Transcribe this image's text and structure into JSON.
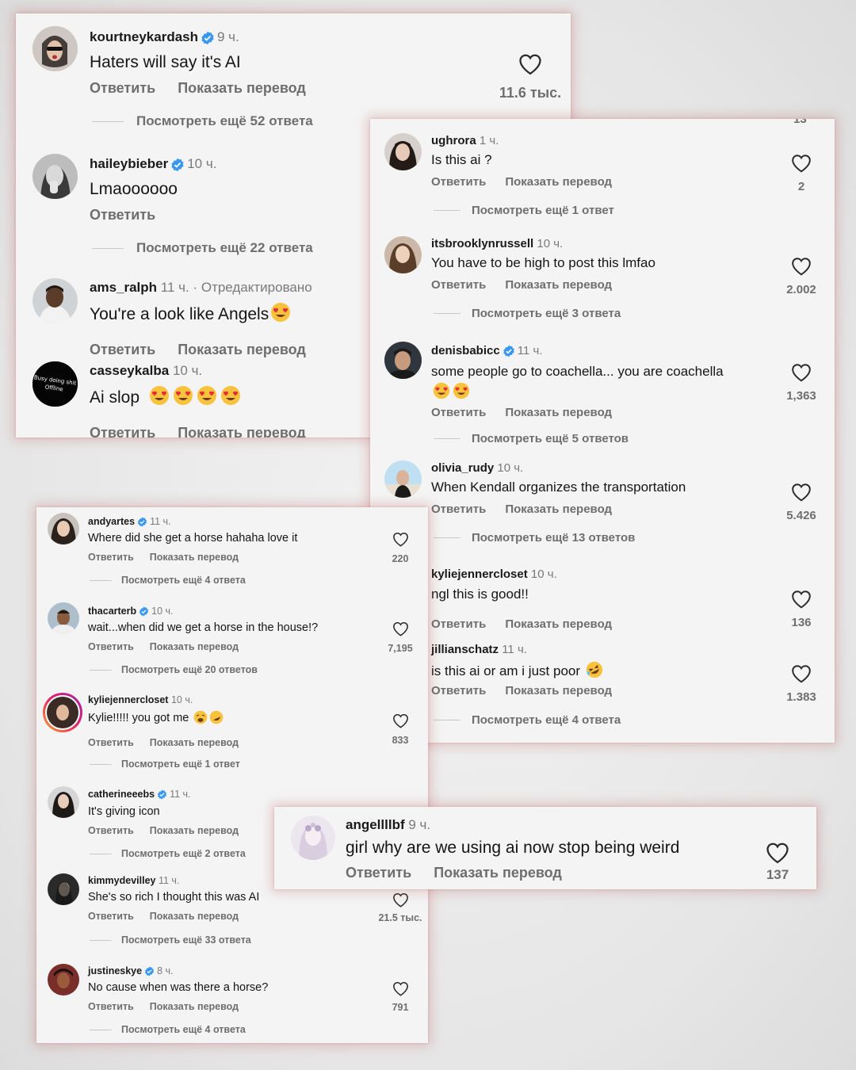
{
  "labels": {
    "reply": "Ответить",
    "translate": "Показать перевод"
  },
  "colors": {
    "verified": "#3897f0",
    "panel_glow": "#c86464",
    "panel_bg": "#f4f4f4"
  },
  "panel_a": {
    "comments": [
      {
        "user": "kourtneykardash",
        "verified": true,
        "time": "9 ч.",
        "text": "Haters will say it's AI",
        "likes": "11.6 тыс.",
        "replies": "Посмотреть ещё 52 ответа",
        "translate": true,
        "avatar_icon": "avatar-icon"
      },
      {
        "user": "haileybieber",
        "verified": true,
        "time": "10 ч.",
        "text": "Lmaoooooo",
        "likes": "",
        "replies": "Посмотреть ещё 22 ответа",
        "translate": false,
        "avatar_icon": "avatar-icon"
      },
      {
        "user": "ams_ralph",
        "verified": false,
        "time": "11 ч. · Отредактировано",
        "text": "You're a look like Angels",
        "emoji_count": 1,
        "likes": "",
        "replies": "",
        "translate": true,
        "avatar_icon": "avatar-icon"
      },
      {
        "user": "casseykalba",
        "verified": false,
        "time": "10 ч.",
        "text": "Ai slop",
        "emoji_count": 4,
        "likes": "",
        "replies": "",
        "translate": true,
        "avatar_text": "Busy doing shit Offline",
        "avatar_icon": "avatar-icon"
      }
    ]
  },
  "panel_b": {
    "top_partial_count": "13",
    "comments": [
      {
        "user": "ughrora",
        "verified": false,
        "time": "1 ч.",
        "text": "Is this ai ?",
        "likes": "2",
        "replies": "Посмотреть ещё 1 ответ"
      },
      {
        "user": "itsbrooklynrussell",
        "verified": false,
        "time": "10 ч.",
        "text": "You have to be high to post this lmfao",
        "likes": "2.002",
        "replies": "Посмотреть ещё 3 ответа"
      },
      {
        "user": "denisbabicc",
        "verified": true,
        "time": "11 ч.",
        "text": "some people go to coachella... you are coachella",
        "emoji_count": 2,
        "likes": "1,363",
        "replies": "Посмотреть ещё 5 ответов"
      },
      {
        "user": "olivia_rudy",
        "verified": false,
        "time": "10 ч.",
        "text": "When Kendall organizes the transportation",
        "likes": "5.426",
        "replies": "Посмотреть ещё 13 ответов"
      },
      {
        "user": "kyliejennercloset",
        "verified": false,
        "time": "10 ч.",
        "text": "ngl this is good!!",
        "likes": "136",
        "replies": ""
      },
      {
        "user": "jillianschatz",
        "verified": false,
        "time": "11 ч.",
        "text": "is this ai or am i just poor",
        "emoji_count": 1,
        "likes": "1.383",
        "replies": "Посмотреть ещё 4 ответа"
      }
    ]
  },
  "panel_c": {
    "comments": [
      {
        "user": "andyartes",
        "verified": true,
        "time": "11 ч.",
        "text": "Where did she get a horse hahaha love it",
        "likes": "220",
        "replies": "Посмотреть ещё 4 ответа"
      },
      {
        "user": "thacarterb",
        "verified": true,
        "time": "10 ч.",
        "text": "wait...when did we get a horse in the house!?",
        "likes": "7,195",
        "replies": "Посмотреть ещё 20 ответов"
      },
      {
        "user": "kyliejennercloset",
        "verified": false,
        "time": "10 ч.",
        "text": "Kylie!!!!! you got me",
        "emoji_count": 2,
        "likes": "833",
        "replies": "Посмотреть ещё 1 ответ"
      },
      {
        "user": "catherineeebs",
        "verified": true,
        "time": "11 ч.",
        "text": "It's giving icon",
        "likes": "",
        "replies": "Посмотреть ещё 2 ответа"
      },
      {
        "user": "kimmydevilley",
        "verified": false,
        "time": "11 ч.",
        "text": "She's so rich I thought this was AI",
        "likes": "21.5 тыс.",
        "replies": "Посмотреть ещё 33 ответа"
      },
      {
        "user": "justineskye",
        "verified": true,
        "time": "8 ч.",
        "text": "No cause when was there a horse?",
        "likes": "791",
        "replies": "Посмотреть ещё 4 ответа"
      }
    ]
  },
  "panel_d": {
    "comments": [
      {
        "user": "angellllbf",
        "verified": false,
        "time": "9 ч.",
        "text": "girl why are we using ai now stop being weird",
        "likes": "137"
      }
    ]
  }
}
